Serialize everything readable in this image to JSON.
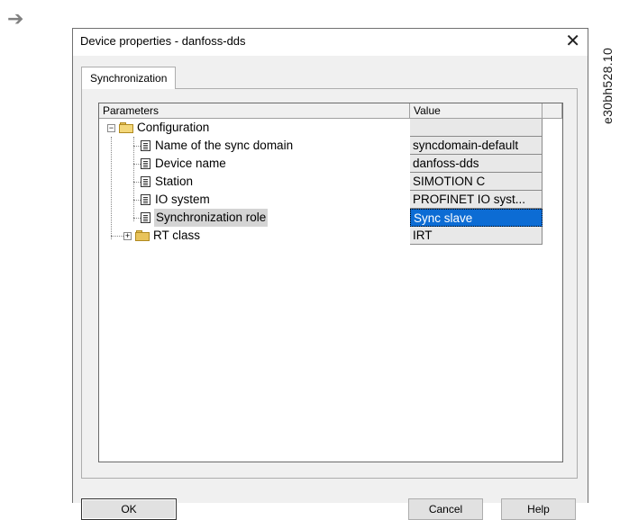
{
  "page": {
    "figure_code": "e30bh528.10"
  },
  "dialog": {
    "title": "Device properties - danfoss-dds",
    "close_glyph": "✕",
    "tab_label": "Synchronization",
    "columns": {
      "parameters": "Parameters",
      "value": "Value"
    },
    "tree": {
      "root_label": "Configuration",
      "items": [
        {
          "label": "Name of the sync domain",
          "value": "syncdomain-default"
        },
        {
          "label": "Device name",
          "value": "danfoss-dds"
        },
        {
          "label": "Station",
          "value": "SIMOTION C"
        },
        {
          "label": "IO system",
          "value": "PROFINET IO syst..."
        },
        {
          "label": "Synchronization role",
          "value": "Sync slave"
        }
      ],
      "rt_class": {
        "label": "RT class",
        "value": "IRT"
      }
    },
    "buttons": {
      "ok": "OK",
      "cancel": "Cancel",
      "help": "Help"
    }
  }
}
